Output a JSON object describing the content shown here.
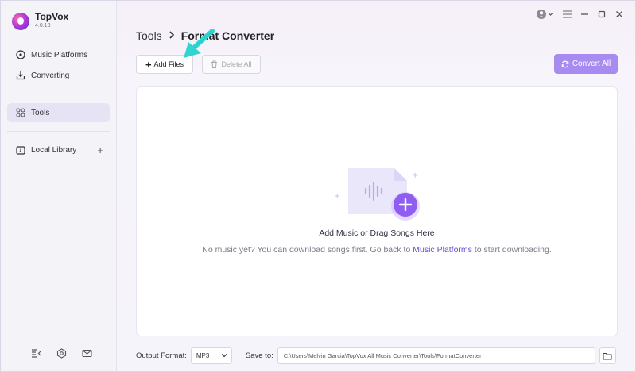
{
  "app": {
    "name": "TopVox",
    "version": "4.0.13"
  },
  "sidebar": {
    "items": [
      {
        "label": "Music Platforms",
        "icon": "music-disc-icon"
      },
      {
        "label": "Converting",
        "icon": "download-icon"
      },
      {
        "label": "Tools",
        "icon": "grid-icon",
        "active": true
      },
      {
        "label": "Local Library",
        "icon": "library-icon"
      }
    ],
    "bottom_icons": [
      "collapse-icon",
      "settings-icon",
      "mail-icon"
    ]
  },
  "header": {
    "breadcrumb_root": "Tools",
    "breadcrumb_current": "Format Converter"
  },
  "toolbar": {
    "add_files_label": "Add Files",
    "delete_all_label": "Delete All",
    "convert_all_label": "Convert All"
  },
  "dropzone": {
    "title": "Add Music or Drag Songs Here",
    "subtitle_pre": "No music yet? You can download songs first. Go back to",
    "subtitle_link": "Music Platforms",
    "subtitle_post": "to start downloading."
  },
  "footer": {
    "output_format_label": "Output Format:",
    "output_format_value": "MP3",
    "save_to_label": "Save to:",
    "save_to_path": "C:\\Users\\Melvin Garcia\\TopVox All Music Converter\\Tools\\FormatConverter"
  },
  "colors": {
    "accent": "#a78bf0",
    "link": "#6c4bd8",
    "annotation_arrow": "#2fd6d1"
  }
}
